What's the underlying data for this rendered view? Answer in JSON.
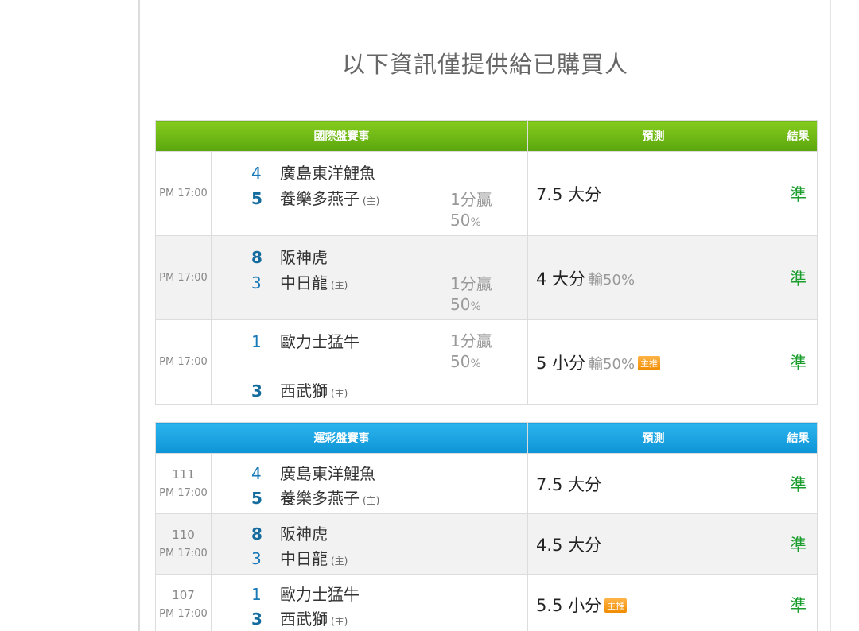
{
  "notice": "以下資訊僅提供給已購買人",
  "international": {
    "headers": {
      "match": "國際盤賽事",
      "prediction": "預測",
      "result": "結果"
    },
    "rows": [
      {
        "time": "PM 17:00",
        "team1_num": "4",
        "team1_name": "廣島東洋鯉魚",
        "team1_home": "",
        "team2_num": "5",
        "team2_name": "養樂多燕子",
        "team2_home": "(主)",
        "spread_main": "1分贏",
        "spread_pct_num": "50",
        "spread_pct_sign": "%",
        "prediction": "7.5 大分",
        "lose": "",
        "badge": "",
        "result": "準"
      },
      {
        "time": "PM 17:00",
        "team1_num": "8",
        "team1_name": "阪神虎",
        "team1_home": "",
        "team2_num": "3",
        "team2_name": "中日龍",
        "team2_home": "(主)",
        "spread_main": "1分贏",
        "spread_pct_num": "50",
        "spread_pct_sign": "%",
        "prediction": "4 大分",
        "lose": "輸50%",
        "badge": "",
        "result": "準"
      },
      {
        "time": "PM 17:00",
        "team1_num": "1",
        "team1_name": "歐力士猛牛",
        "team1_home": "",
        "team2_num": "3",
        "team2_name": "西武獅",
        "team2_home": "(主)",
        "spread_main": "1分贏",
        "spread_pct_num": "50",
        "spread_pct_sign": "%",
        "prediction": "5 小分",
        "lose": "輸50%",
        "badge": "主推",
        "result": "準"
      }
    ]
  },
  "sport_lottery": {
    "headers": {
      "match": "運彩盤賽事",
      "prediction": "預測",
      "result": "結果"
    },
    "rows": [
      {
        "game_no": "111",
        "time": "PM 17:00",
        "team1_num": "4",
        "team1_name": "廣島東洋鯉魚",
        "team1_home": "",
        "team2_num": "5",
        "team2_name": "養樂多燕子",
        "team2_home": "(主)",
        "prediction": "7.5 大分",
        "badge": "",
        "result": "準"
      },
      {
        "game_no": "110",
        "time": "PM 17:00",
        "team1_num": "8",
        "team1_name": "阪神虎",
        "team1_home": "",
        "team2_num": "3",
        "team2_name": "中日龍",
        "team2_home": "(主)",
        "prediction": "4.5 大分",
        "badge": "",
        "result": "準"
      },
      {
        "game_no": "107",
        "time": "PM 17:00",
        "team1_num": "1",
        "team1_name": "歐力士猛牛",
        "team1_home": "",
        "team2_num": "3",
        "team2_name": "西武獅",
        "team2_home": "(主)",
        "prediction": "5.5 小分",
        "badge": "主推",
        "result": "準"
      }
    ]
  },
  "colors": {
    "international_header": "#6bb615",
    "sport_lottery_header": "#1aa3e2",
    "result_text": "#1b9e2e",
    "team_number": "#1a7ab8"
  }
}
